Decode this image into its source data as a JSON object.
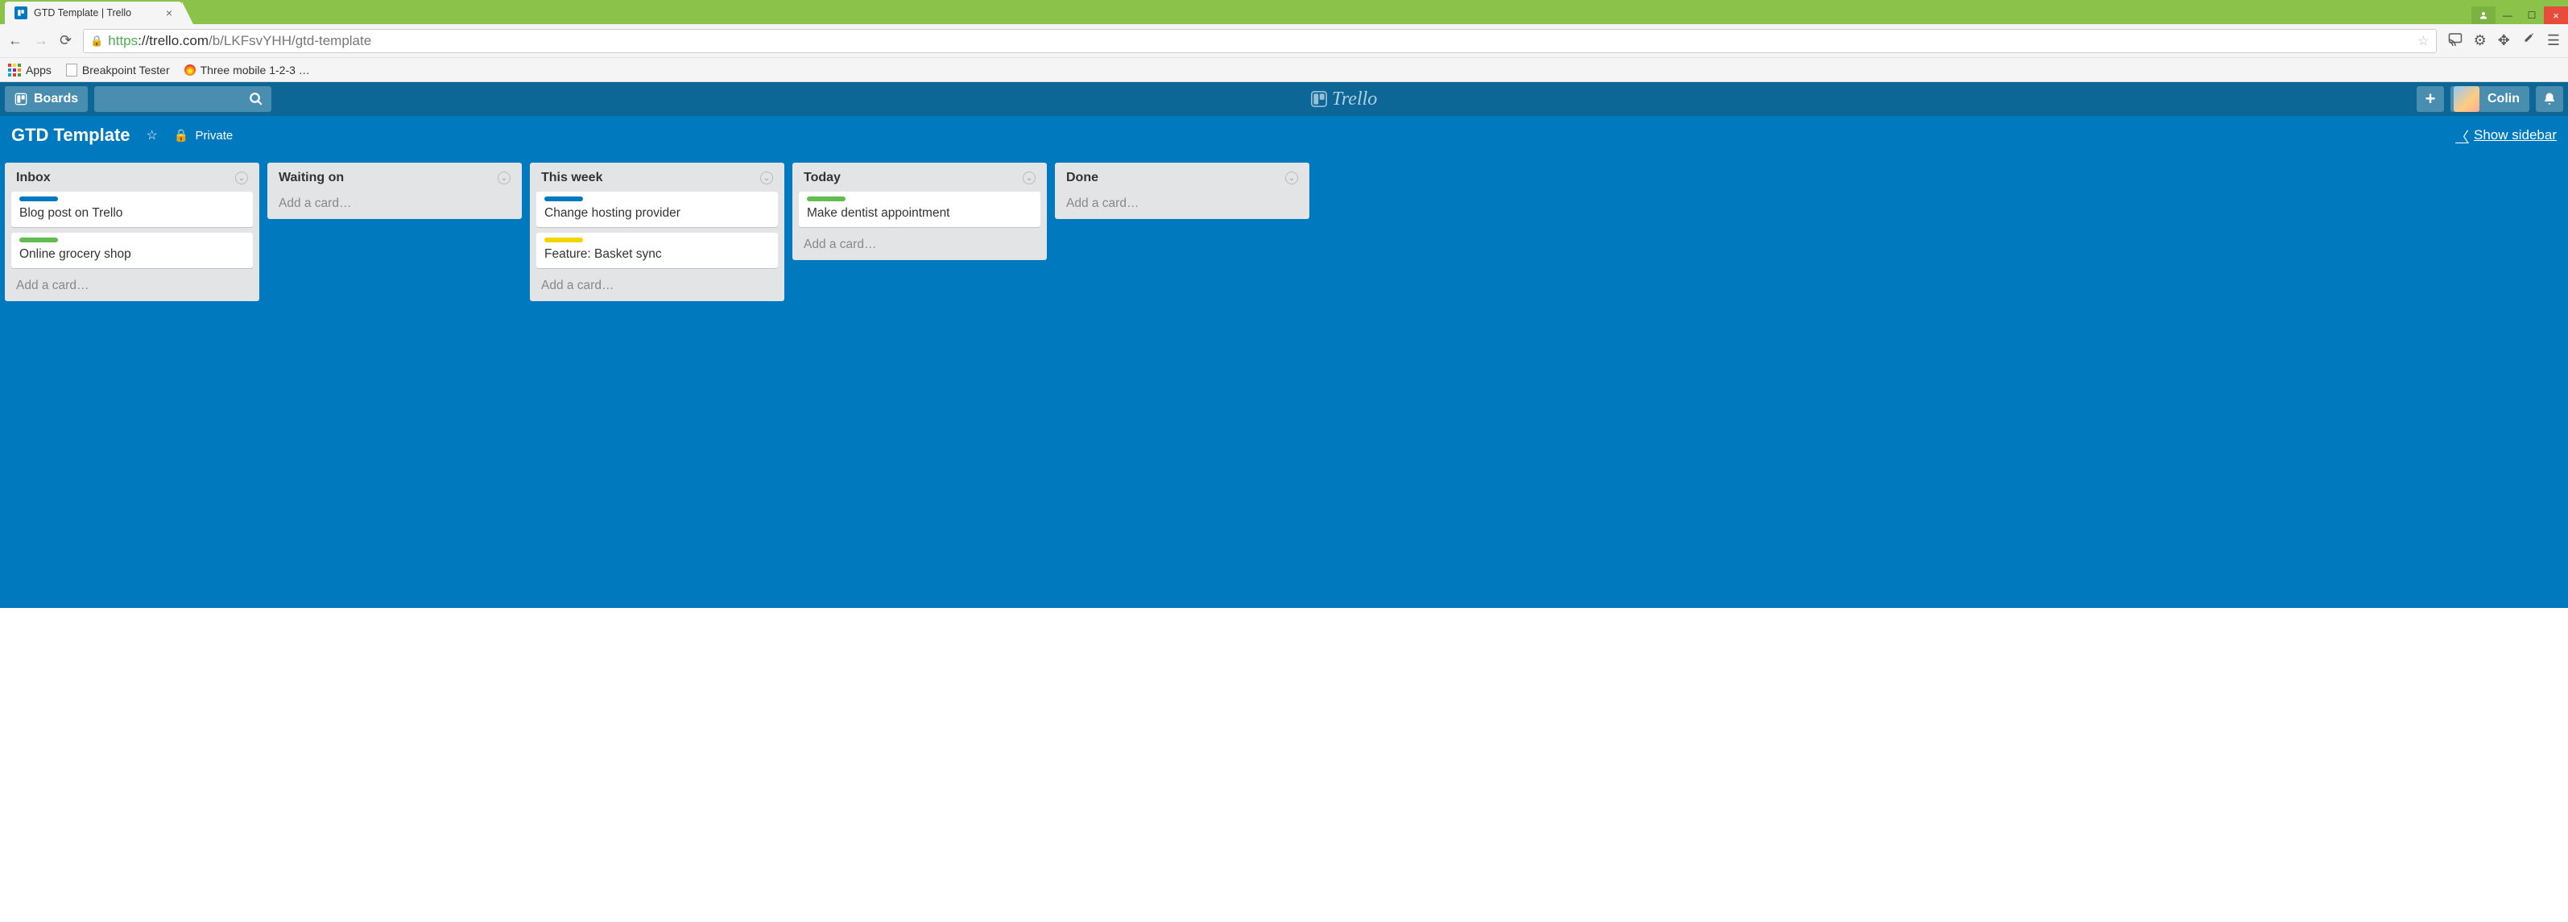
{
  "browser": {
    "tab_title": "GTD Template | Trello",
    "url_proto": "https",
    "url_host": "://trello.com",
    "url_path": "/b/LKFsvYHH/gtd-template",
    "bookmarks": {
      "apps": "Apps",
      "breakpoint": "Breakpoint Tester",
      "three": "Three mobile 1-2-3 …"
    }
  },
  "header": {
    "boards": "Boards",
    "logo": "Trello",
    "username": "Colin"
  },
  "board": {
    "title": "GTD Template",
    "privacy": "Private",
    "show_sidebar": "Show sidebar",
    "add_card": "Add a card…"
  },
  "lists": [
    {
      "title": "Inbox",
      "cards": [
        {
          "label": "blue",
          "title": "Blog post on Trello"
        },
        {
          "label": "green",
          "title": "Online grocery shop"
        }
      ]
    },
    {
      "title": "Waiting on",
      "cards": []
    },
    {
      "title": "This week",
      "cards": [
        {
          "label": "blue",
          "title": "Change hosting provider"
        },
        {
          "label": "yellow",
          "title": "Feature: Basket sync"
        }
      ]
    },
    {
      "title": "Today",
      "cards": [
        {
          "label": "green",
          "title": "Make dentist appointment"
        }
      ]
    },
    {
      "title": "Done",
      "cards": []
    }
  ]
}
